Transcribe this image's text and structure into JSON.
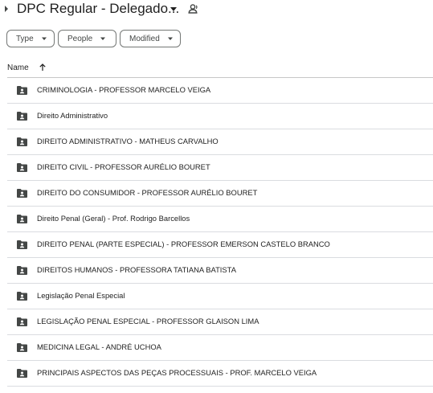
{
  "header": {
    "title": "DPC Regular - Delegado...",
    "expand_icon": "chevron-right-icon",
    "title_dropdown_icon": "caret-down-icon",
    "shared_icon": "shared-folder-person-icon"
  },
  "filters": [
    {
      "label": "Type"
    },
    {
      "label": "People"
    },
    {
      "label": "Modified"
    }
  ],
  "columns": {
    "name_label": "Name",
    "sort_icon": "arrow-up-icon"
  },
  "folders": [
    {
      "name": "CRIMINOLOGIA - PROFESSOR MARCELO VEIGA"
    },
    {
      "name": "Direito Administrativo"
    },
    {
      "name": "DIREITO ADMINISTRATIVO - MATHEUS CARVALHO"
    },
    {
      "name": "DIREITO CIVIL - PROFESSOR AURÉLIO BOURET"
    },
    {
      "name": "DIREITO DO CONSUMIDOR - PROFESSOR AURÉLIO BOURET"
    },
    {
      "name": "Direito Penal (Geral) - Prof. Rodrigo Barcellos"
    },
    {
      "name": "DIREITO PENAL (PARTE ESPECIAL) - PROFESSOR EMERSON CASTELO BRANCO"
    },
    {
      "name": "DIREITOS HUMANOS - PROFESSORA TATIANA BATISTA"
    },
    {
      "name": "Legislação Penal Especial"
    },
    {
      "name": "LEGISLAÇÃO PENAL ESPECIAL - PROFESSOR GLAISON LIMA"
    },
    {
      "name": "MEDICINA LEGAL - ANDRÉ UCHOA"
    },
    {
      "name": "PRINCIPAIS ASPECTOS DAS PEÇAS PROCESSUAIS - PROF. MARCELO VEIGA"
    }
  ],
  "colors": {
    "text": "#1f1f1f",
    "icon": "#444746",
    "divider": "#dadce0"
  }
}
